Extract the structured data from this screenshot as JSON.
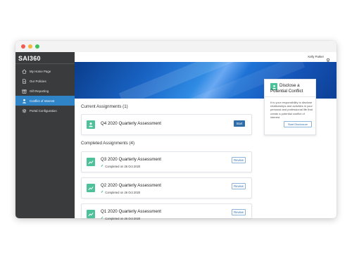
{
  "app": {
    "logo": "SAI360"
  },
  "sidebar": {
    "items": [
      {
        "label": "My Home Page",
        "icon": "home-icon"
      },
      {
        "label": "Our Policies",
        "icon": "policies-icon"
      },
      {
        "label": "Gift Reporting",
        "icon": "gift-icon"
      },
      {
        "label": "Conflict of Interest",
        "icon": "conflict-icon",
        "active": true
      },
      {
        "label": "Portal Configuration",
        "icon": "gear-icon"
      }
    ]
  },
  "header": {
    "user_name": "Kelly Parker"
  },
  "current": {
    "title": "Current Assignments (1)",
    "items": [
      {
        "title": "Q4 2020 Quarterly Assessment",
        "button": "Start"
      }
    ]
  },
  "completed": {
    "title": "Completed Assignments (4)",
    "items": [
      {
        "title": "Q3 2020 Quarterly Assessment",
        "status": "Completed on 26 Oct 2020",
        "button": "Review"
      },
      {
        "title": "Q2 2020 Quarterly Assessment",
        "status": "Completed on 26 Oct 2020",
        "button": "Review"
      },
      {
        "title": "Q1 2020 Quarterly Assessment",
        "status": "Completed on 26 Oct 2020",
        "button": "Review"
      }
    ]
  },
  "disclose": {
    "title": "Disclose a Potential Conflict",
    "text": "It is your responsibility to disclose relationships and activities in your personal and professional life that create a potential conflict of interest.",
    "button": "Start Disclosure"
  },
  "colors": {
    "accent": "#2f83c7",
    "sidebar": "#3a3b3c",
    "assignment_icon": "#4cc19a",
    "start_button": "#2f6ea8"
  }
}
